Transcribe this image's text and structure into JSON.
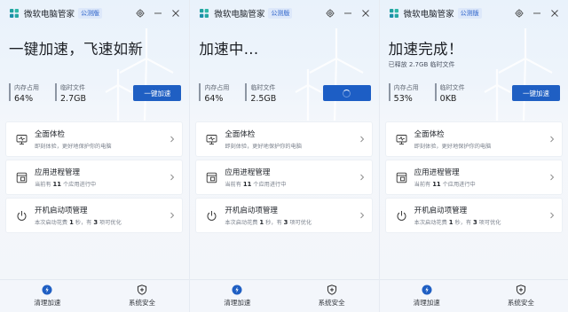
{
  "panels": [
    {
      "app_title": "微软电脑管家",
      "badge": "公测版",
      "hero_title": "一键加速，飞速如新",
      "hero_sub": "",
      "stats": [
        {
          "label": "内存占用",
          "value": "64%"
        },
        {
          "label": "临时文件",
          "value": "2.7GB"
        }
      ],
      "button": {
        "label": "一键加速",
        "state": "idle"
      },
      "cards": [
        {
          "title": "全面体检",
          "desc_prefix": "即刻体验，更好地保护你的电脑",
          "desc_num1": "",
          "desc_mid": "",
          "desc_num2": "",
          "desc_suffix": "",
          "icon": "monitor-check-icon"
        },
        {
          "title": "应用进程管理",
          "desc_prefix": "当前有 ",
          "desc_num1": "11",
          "desc_mid": " 个应用进行中",
          "desc_num2": "",
          "desc_suffix": "",
          "icon": "app-process-icon"
        },
        {
          "title": "开机启动项管理",
          "desc_prefix": "本次启动花费 ",
          "desc_num1": "1",
          "desc_mid": " 秒，有 ",
          "desc_num2": "3",
          "desc_suffix": " 项可优化",
          "icon": "power-icon"
        }
      ],
      "nav": [
        {
          "label": "清理加速",
          "icon": "cleanup-boost-icon",
          "active": true
        },
        {
          "label": "系统安全",
          "icon": "shield-icon",
          "active": false
        }
      ]
    },
    {
      "app_title": "微软电脑管家",
      "badge": "公测版",
      "hero_title": "加速中...",
      "hero_sub": "",
      "stats": [
        {
          "label": "内存占用",
          "value": "64%"
        },
        {
          "label": "临时文件",
          "value": "2.5GB"
        }
      ],
      "button": {
        "label": "",
        "state": "loading"
      },
      "cards": [
        {
          "title": "全面体检",
          "desc_prefix": "即刻体验，更好地保护你的电脑",
          "desc_num1": "",
          "desc_mid": "",
          "desc_num2": "",
          "desc_suffix": "",
          "icon": "monitor-check-icon"
        },
        {
          "title": "应用进程管理",
          "desc_prefix": "当前有 ",
          "desc_num1": "11",
          "desc_mid": " 个应用进行中",
          "desc_num2": "",
          "desc_suffix": "",
          "icon": "app-process-icon"
        },
        {
          "title": "开机启动项管理",
          "desc_prefix": "本次启动花费 ",
          "desc_num1": "1",
          "desc_mid": " 秒，有 ",
          "desc_num2": "3",
          "desc_suffix": " 项可优化",
          "icon": "power-icon"
        }
      ],
      "nav": [
        {
          "label": "清理加速",
          "icon": "cleanup-boost-icon",
          "active": true
        },
        {
          "label": "系统安全",
          "icon": "shield-icon",
          "active": false
        }
      ]
    },
    {
      "app_title": "微软电脑管家",
      "badge": "公测版",
      "hero_title": "加速完成！",
      "hero_sub": "已释放 2.7GB 临时文件",
      "stats": [
        {
          "label": "内存占用",
          "value": "53%"
        },
        {
          "label": "临时文件",
          "value": "0KB"
        }
      ],
      "button": {
        "label": "一键加速",
        "state": "idle"
      },
      "cards": [
        {
          "title": "全面体检",
          "desc_prefix": "即刻体验，更好地保护你的电脑",
          "desc_num1": "",
          "desc_mid": "",
          "desc_num2": "",
          "desc_suffix": "",
          "icon": "monitor-check-icon"
        },
        {
          "title": "应用进程管理",
          "desc_prefix": "当前有 ",
          "desc_num1": "11",
          "desc_mid": " 个应用进行中",
          "desc_num2": "",
          "desc_suffix": "",
          "icon": "app-process-icon"
        },
        {
          "title": "开机启动项管理",
          "desc_prefix": "本次启动花费 ",
          "desc_num1": "1",
          "desc_mid": " 秒，有 ",
          "desc_num2": "3",
          "desc_suffix": " 项可优化",
          "icon": "power-icon"
        }
      ],
      "nav": [
        {
          "label": "清理加速",
          "icon": "cleanup-boost-icon",
          "active": true
        },
        {
          "label": "系统安全",
          "icon": "shield-icon",
          "active": false
        }
      ]
    }
  ],
  "colors": {
    "accent": "#1f5fc3",
    "background": "#eef4fb",
    "card": "#ffffff"
  }
}
